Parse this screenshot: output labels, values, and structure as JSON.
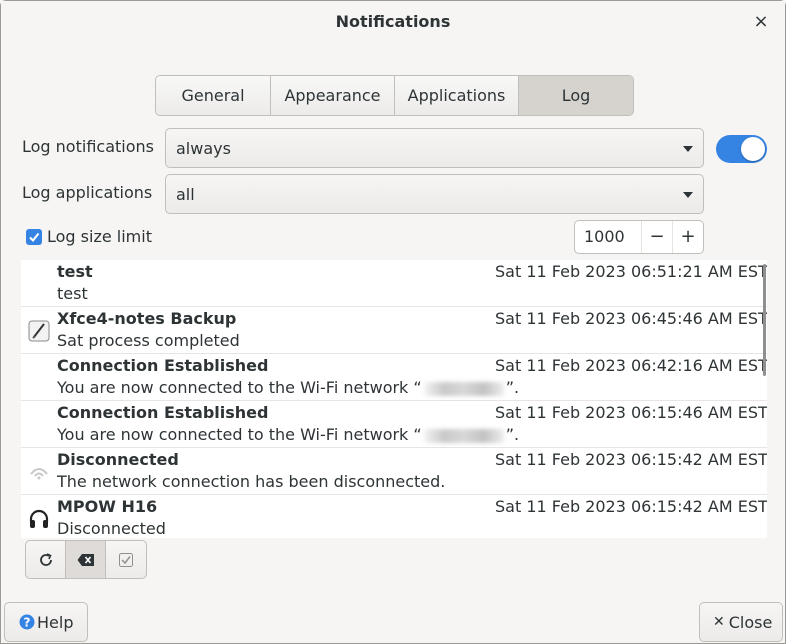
{
  "window": {
    "title": "Notifications",
    "close_glyph": "×"
  },
  "tabs": [
    {
      "label": "General"
    },
    {
      "label": "Appearance"
    },
    {
      "label": "Applications"
    },
    {
      "label": "Log",
      "active": true
    }
  ],
  "log_notifications": {
    "label": "Log notifications",
    "value": "always",
    "enabled": true
  },
  "log_applications": {
    "label": "Log applications",
    "value": "all"
  },
  "log_size_limit": {
    "label": "Log size limit",
    "checked": true,
    "value": "1000",
    "minus": "−",
    "plus": "+"
  },
  "entries": [
    {
      "title": "test",
      "body": "test",
      "time": "Sat 11 Feb 2023 06:51:21 AM EST",
      "icon": "none"
    },
    {
      "title": "Xfce4-notes Backup",
      "body": "Sat process completed",
      "time": "Sat 11 Feb 2023 06:45:46 AM EST",
      "icon": "notes-icon"
    },
    {
      "title": "Connection Established",
      "body_prefix": "You are now connected to the Wi-Fi network “",
      "body_suffix": "”.",
      "time": "Sat 11 Feb 2023 06:42:16 AM EST",
      "icon": "none"
    },
    {
      "title": "Connection Established",
      "body_prefix": "You are now connected to the Wi-Fi network “",
      "body_suffix": "”.",
      "time": "Sat 11 Feb 2023 06:15:46 AM EST",
      "icon": "none"
    },
    {
      "title": "Disconnected",
      "body": "The network connection has been disconnected.",
      "time": "Sat 11 Feb 2023 06:15:42 AM EST",
      "icon": "network-offline-icon"
    },
    {
      "title": "MPOW H16",
      "body": "Disconnected",
      "time": "Sat 11 Feb 2023 06:15:42 AM EST",
      "icon": "headphones-icon"
    }
  ],
  "toolbar": {
    "refresh_icon": "refresh-icon",
    "clear_icon": "backspace-clear-icon",
    "mark_read_icon": "checkbox-icon"
  },
  "footer": {
    "help_label": "Help",
    "close_label": "Close"
  },
  "colors": {
    "accent": "#3584e4",
    "background": "#f6f5f4"
  }
}
